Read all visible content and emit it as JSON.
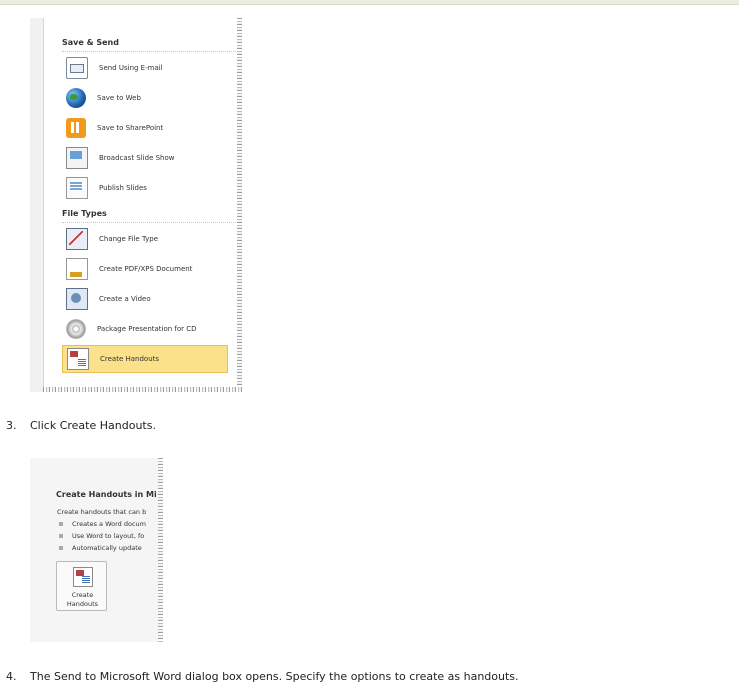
{
  "screenshot1": {
    "sections": [
      {
        "heading": "Save & Send",
        "items": [
          {
            "label": "Send Using E-mail",
            "icon": "email-icon"
          },
          {
            "label": "Save to Web",
            "icon": "globe-icon"
          },
          {
            "label": "Save to SharePoint",
            "icon": "sharepoint-icon"
          },
          {
            "label": "Broadcast Slide Show",
            "icon": "broadcast-icon"
          },
          {
            "label": "Publish Slides",
            "icon": "publish-slides-icon"
          }
        ]
      },
      {
        "heading": "File Types",
        "items": [
          {
            "label": "Change File Type",
            "icon": "change-file-type-icon"
          },
          {
            "label": "Create PDF/XPS Document",
            "icon": "pdf-document-icon"
          },
          {
            "label": "Create a Video",
            "icon": "video-icon"
          },
          {
            "label": "Package Presentation for CD",
            "icon": "cd-icon"
          },
          {
            "label": "Create Handouts",
            "icon": "handouts-icon",
            "selected": true
          }
        ]
      }
    ],
    "selected_color": "#fbe18a"
  },
  "step3": {
    "number": "3.",
    "text": "Click Create Handouts."
  },
  "screenshot2": {
    "title": "Create Handouts in Mi",
    "description": "Create handouts that can b",
    "bullets": [
      "Creates a Word docum",
      "Use Word to layout, fo",
      "Automatically update"
    ],
    "button_line1": "Create",
    "button_line2": "Handouts"
  },
  "step4": {
    "number": "4.",
    "text": "The Send to Microsoft Word dialog box opens. Specify the options to create as handouts."
  }
}
